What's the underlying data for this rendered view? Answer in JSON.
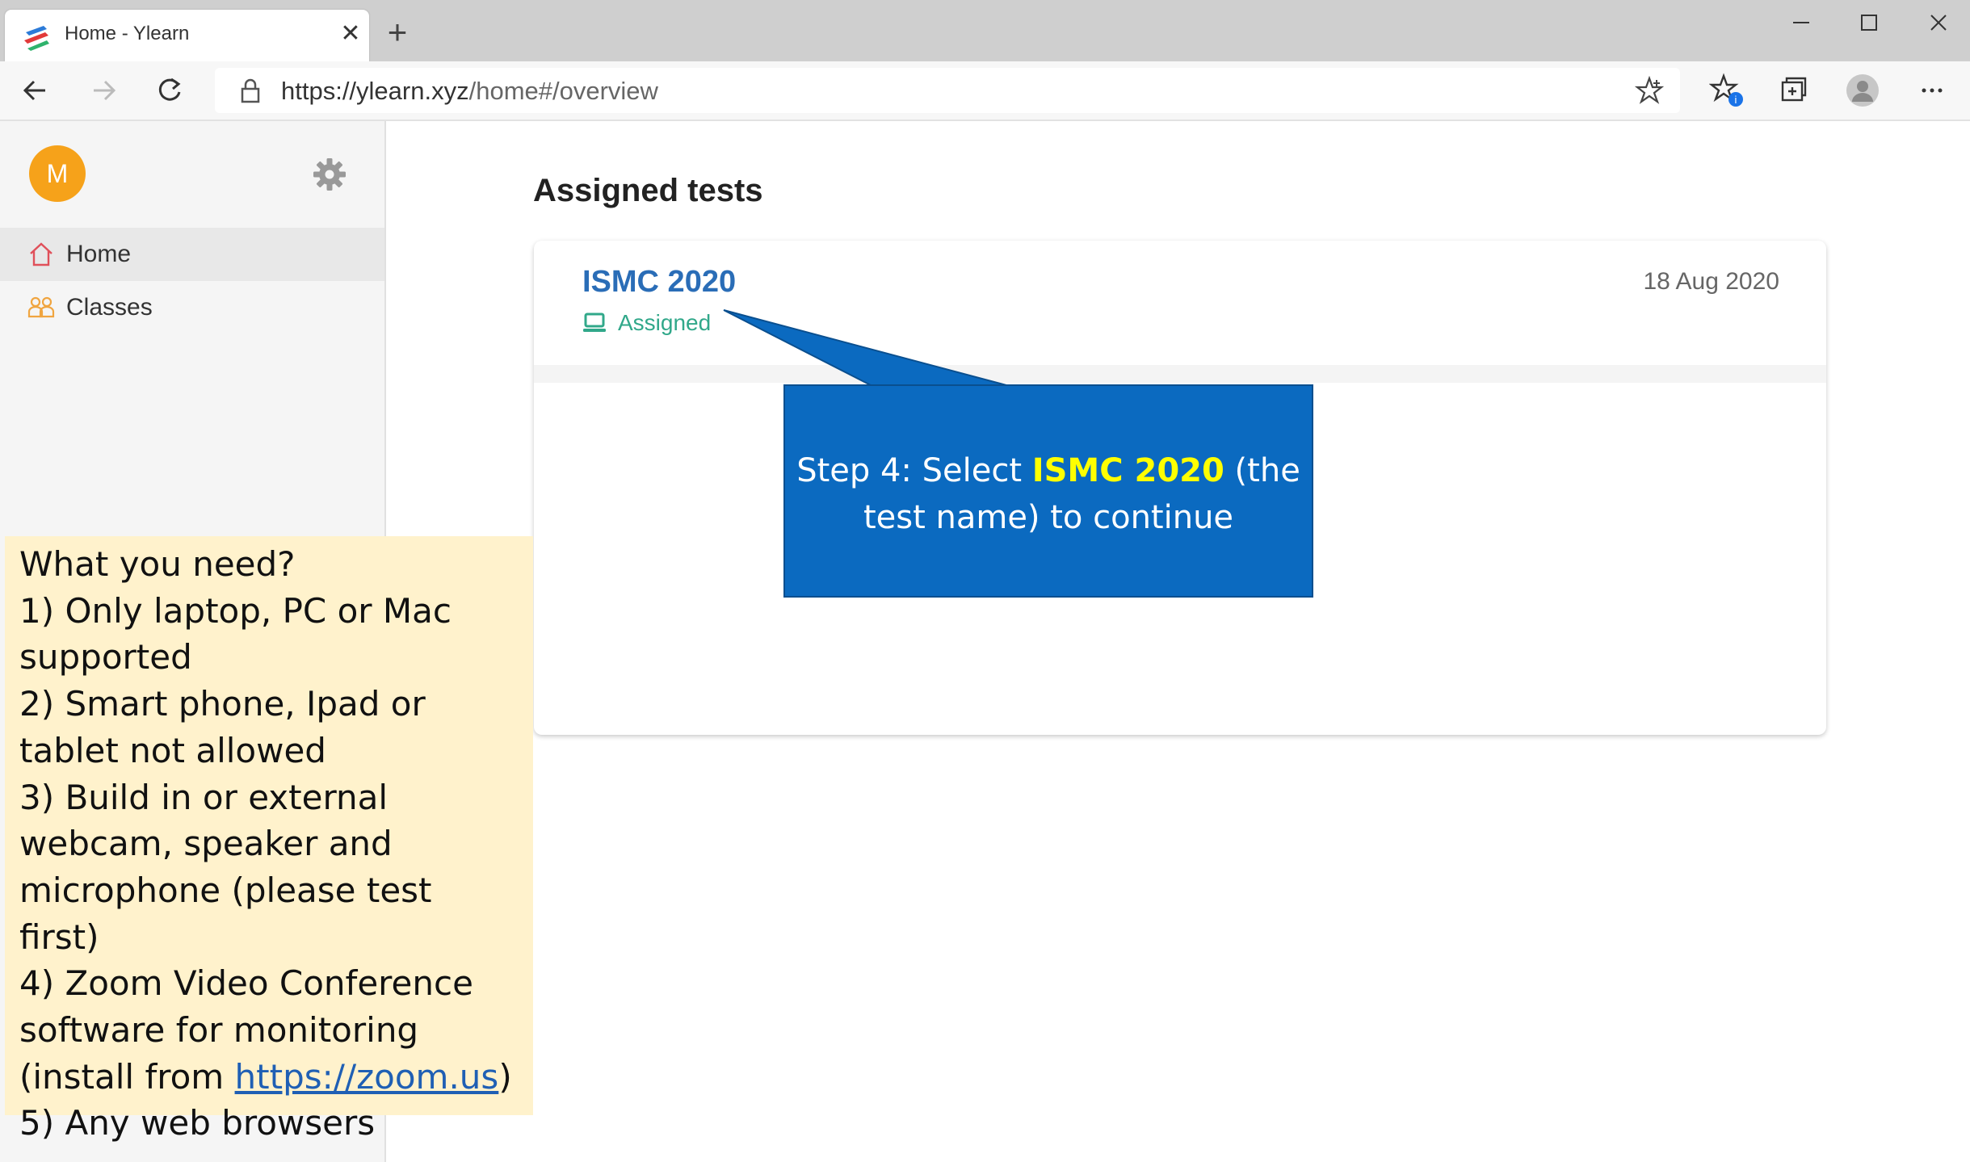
{
  "browser": {
    "tab_title": "Home - Ylearn",
    "url_host": "https://ylearn.xyz",
    "url_path": "/home#/overview"
  },
  "sidebar": {
    "avatar_initial": "M",
    "items": [
      {
        "label": "Home",
        "icon": "home-icon",
        "active": true
      },
      {
        "label": "Classes",
        "icon": "classes-icon",
        "active": false
      }
    ]
  },
  "main": {
    "heading": "Assigned tests",
    "test": {
      "name": "ISMC 2020",
      "status": "Assigned",
      "date": "18 Aug 2020"
    }
  },
  "callout": {
    "prefix": "Step 4: Select ",
    "highlight": "ISMC 2020",
    "suffix": " (the test name) to continue"
  },
  "notes": {
    "title": "What you need?",
    "item1": "1) Only laptop, PC or Mac supported",
    "item2": "2) Smart phone, Ipad or tablet not allowed",
    "item3": "3) Build in or external webcam, speaker and microphone (please test first)",
    "item4_prefix": "4) Zoom Video Conference software for monitoring (install from ",
    "item4_link": "https://zoom.us",
    "item4_suffix": ")",
    "item5": "5) Any web browsers"
  },
  "colors": {
    "accent": "#2a6db7",
    "status": "#31a88a",
    "avatar": "#f6a21a",
    "callout": "#0b6ac0",
    "callout_highlight": "#ffff00",
    "note_bg": "#fff2cc"
  }
}
